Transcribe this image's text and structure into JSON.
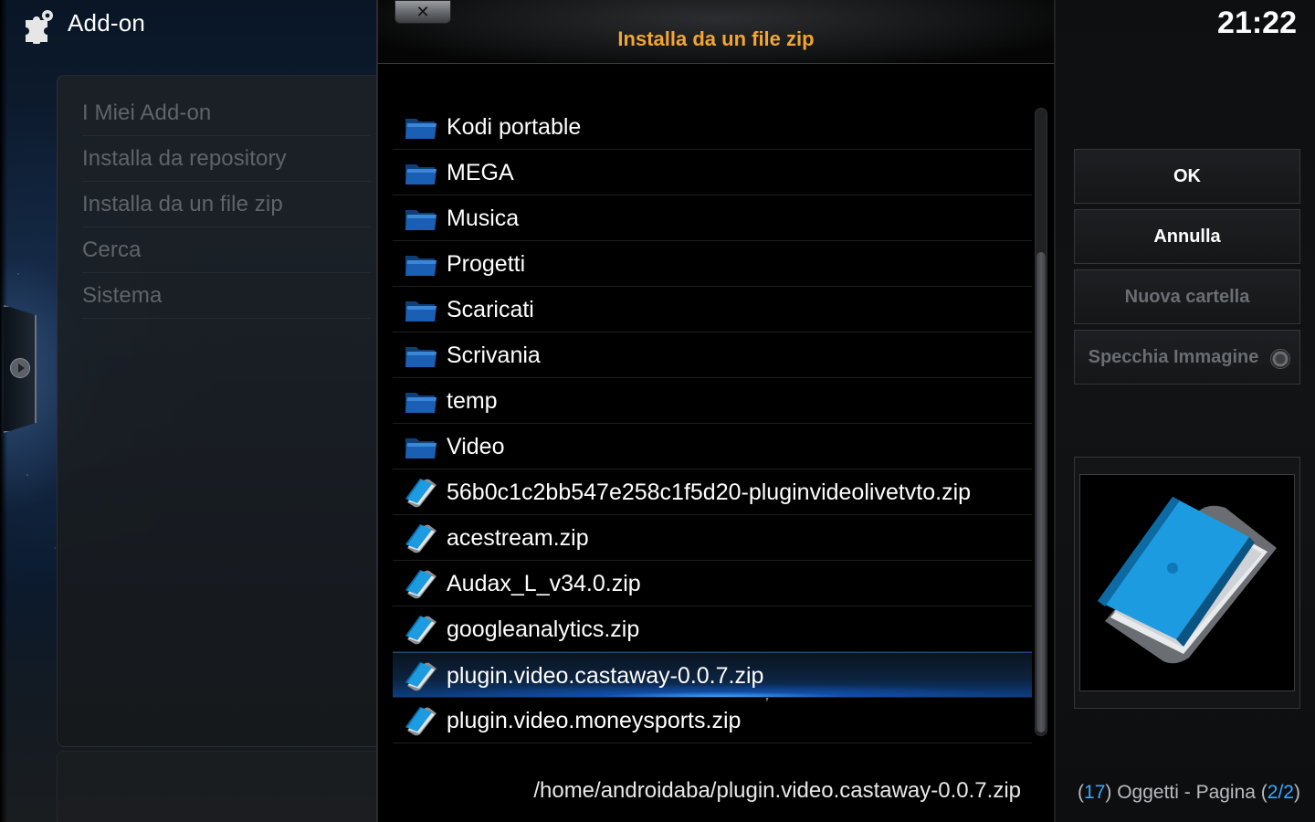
{
  "header": {
    "title": "Add-on",
    "icon": "puzzle-gear-icon"
  },
  "menu": {
    "items": [
      {
        "label": "I Miei Add-on"
      },
      {
        "label": "Installa da repository"
      },
      {
        "label": "Installa da un file zip"
      },
      {
        "label": "Cerca"
      },
      {
        "label": "Sistema"
      }
    ]
  },
  "dialog": {
    "title": "Installa da un file zip",
    "close_icon": "close-icon",
    "close_label": "✕",
    "files": [
      {
        "label": "Kodi portable",
        "icon": "folder-icon"
      },
      {
        "label": "MEGA",
        "icon": "folder-icon"
      },
      {
        "label": "Musica",
        "icon": "folder-icon"
      },
      {
        "label": "Progetti",
        "icon": "folder-icon"
      },
      {
        "label": "Scaricati",
        "icon": "folder-icon"
      },
      {
        "label": "Scrivania",
        "icon": "folder-icon"
      },
      {
        "label": "temp",
        "icon": "folder-icon"
      },
      {
        "label": "Video",
        "icon": "folder-icon"
      },
      {
        "label": "56b0c1c2bb547e258c1f5d20-pluginvideolivetvto.zip",
        "icon": "zip-file-icon"
      },
      {
        "label": "acestream.zip",
        "icon": "zip-file-icon"
      },
      {
        "label": "Audax_L_v34.0.zip",
        "icon": "zip-file-icon"
      },
      {
        "label": "googleanalytics.zip",
        "icon": "zip-file-icon"
      },
      {
        "label": "plugin.video.castaway-0.0.7.zip",
        "icon": "zip-file-icon",
        "focused": true
      },
      {
        "label": "plugin.video.moneysports.zip",
        "icon": "zip-file-icon"
      }
    ],
    "current_path": "/home/androidaba/plugin.video.castaway-0.0.7.zip"
  },
  "clock": "21:22",
  "buttons": {
    "ok": "OK",
    "cancel": "Annulla",
    "new_folder": "Nuova cartella",
    "mirror_image": "Specchia Immagine"
  },
  "status": {
    "open_paren": "(",
    "count": "17",
    "items_text": ") Oggetti - Pagina (",
    "page": "2/2",
    "close_paren": ")"
  },
  "colors": {
    "accent": "#3aa6ff",
    "title_orange": "#f2a531",
    "folder_blue": "#1a5fb4"
  }
}
